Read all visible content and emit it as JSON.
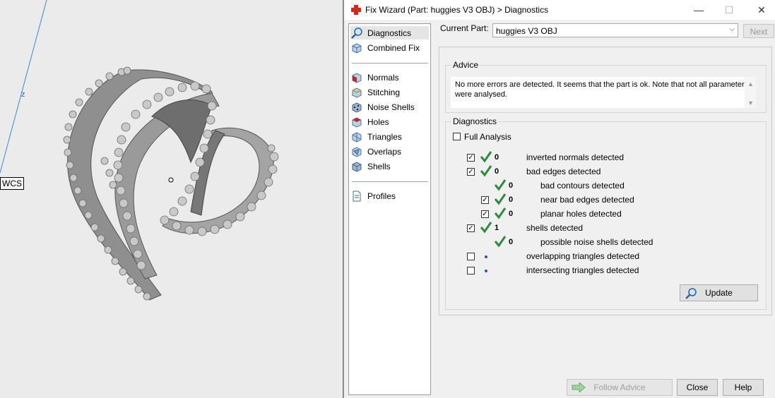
{
  "viewport": {
    "axis_label": "z",
    "wcs_label": "WCS"
  },
  "dialog": {
    "title": "Fix Wizard (Part: huggies V3 OBJ) > Diagnostics",
    "window_buttons": {
      "minimize": "—",
      "maximize": "☐",
      "close": "✕"
    },
    "sidebar": {
      "items": [
        {
          "label": "Diagnostics",
          "icon": "magnifier-icon",
          "selected": true
        },
        {
          "label": "Combined Fix",
          "icon": "cube-icon"
        },
        {
          "label": "Normals",
          "icon": "normals-cube-icon"
        },
        {
          "label": "Stitching",
          "icon": "stitching-cube-icon"
        },
        {
          "label": "Noise Shells",
          "icon": "noise-shells-icon"
        },
        {
          "label": "Holes",
          "icon": "holes-cube-icon"
        },
        {
          "label": "Triangles",
          "icon": "triangles-cube-icon"
        },
        {
          "label": "Overlaps",
          "icon": "overlaps-cube-icon"
        },
        {
          "label": "Shells",
          "icon": "shells-cube-icon"
        },
        {
          "label": "Profiles",
          "icon": "document-icon"
        }
      ]
    },
    "current_part_label": "Current Part:",
    "current_part_value": "huggies V3 OBJ",
    "next_label": "Next",
    "advice": {
      "title": "Advice",
      "text": "No more errors are detected. It seems that the part is ok. Note that not all parameters were analysed."
    },
    "diagnostics": {
      "title": "Diagnostics",
      "full_analysis_label": "Full Analysis",
      "full_analysis_checked": false,
      "rows": [
        {
          "checkbox": true,
          "checked": true,
          "status": "ok",
          "count": "0",
          "label": "inverted normals detected"
        },
        {
          "checkbox": true,
          "checked": true,
          "status": "ok",
          "count": "0",
          "label": "bad edges detected"
        },
        {
          "checkbox": false,
          "checked": false,
          "status": "ok",
          "count": "0",
          "label": "bad contours detected"
        },
        {
          "checkbox": true,
          "checked": true,
          "status": "ok",
          "count": "0",
          "label": "near bad edges detected"
        },
        {
          "checkbox": true,
          "checked": true,
          "status": "ok",
          "count": "0",
          "label": "planar holes detected"
        },
        {
          "checkbox": true,
          "checked": true,
          "status": "ok",
          "count": "1",
          "label": "shells detected"
        },
        {
          "checkbox": false,
          "checked": false,
          "status": "ok",
          "count": "0",
          "label": "possible noise shells detected"
        },
        {
          "checkbox": true,
          "checked": false,
          "status": "dot",
          "count": "",
          "label": "overlapping triangles detected"
        },
        {
          "checkbox": true,
          "checked": false,
          "status": "dot",
          "count": "",
          "label": "intersecting triangles detected"
        }
      ],
      "update_label": "Update"
    },
    "footer": {
      "follow_advice_label": "Follow Advice",
      "close_label": "Close",
      "help_label": "Help"
    }
  }
}
